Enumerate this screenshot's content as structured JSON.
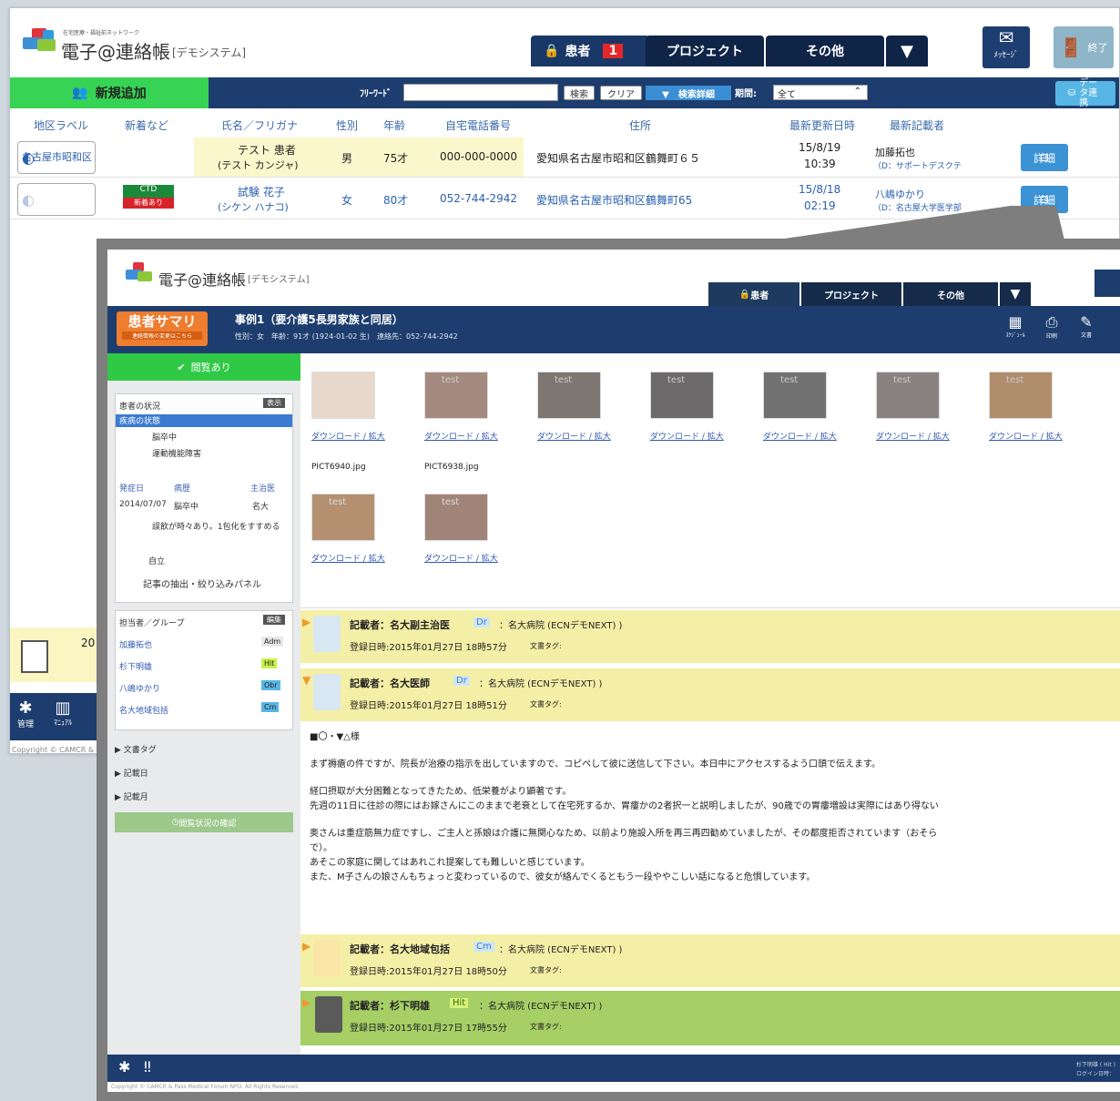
{
  "back": {
    "app_subtitle": "在宅医療・福祉前ネットワーク",
    "app_title": "電子@連絡帳",
    "app_title_suffix": "[デモシステム]",
    "tabs": [
      {
        "label": "患者",
        "badge": "1"
      },
      {
        "label": "プロジェクト"
      },
      {
        "label": "その他"
      }
    ],
    "message_label": "ﾒｯｾｰｼﾞ",
    "exit_label": "終了",
    "new_add": "新規追加",
    "freeword_label": "ﾌﾘｰﾜｰﾄﾞ",
    "search_label": "検索",
    "clear_label": "クリア",
    "detail_search_label": "検索詳細",
    "period_label": "期間:",
    "period_value": "全て",
    "data_link": "データ連携",
    "columns": [
      "地区ラベル",
      "新着など",
      "氏名／フリガナ",
      "性別",
      "年齢",
      "自宅電話番号",
      "住所",
      "最新更新日時",
      "最新記載者"
    ],
    "rows": [
      {
        "area": "名古屋市昭和区",
        "badges": [],
        "name": "テスト 患者",
        "kana": "(テスト カンジャ)",
        "sex": "男",
        "age": "75才",
        "phone": "000-000-0000",
        "address": "愛知県名古屋市昭和区鶴舞町６５",
        "date": "15/8/19",
        "time": "10:39",
        "writer": "加藤拓也",
        "writer_org": "（D：サポートデスクテ",
        "detail": "詳細"
      },
      {
        "area": "",
        "badges": [
          "CTD",
          "新着あり"
        ],
        "name": "試験 花子",
        "kana": "(シケン ハナコ)",
        "sex": "女",
        "age": "80才",
        "phone": "052-744-2942",
        "address": "愛知県名古屋市昭和区鶴舞町65",
        "date": "15/8/18",
        "time": "02:19",
        "writer": "八嶋ゆかり",
        "writer_org": "（D：名古屋大学医学部",
        "detail": "詳細"
      }
    ],
    "side_count": "20",
    "bottom_icons": [
      "管理",
      "ﾏﾆｭｱﾙ"
    ],
    "copyright": "Copyright © CAMCR & T"
  },
  "front": {
    "app_title": "電子@連絡帳",
    "app_title_suffix": "[デモシステム]",
    "tabs": [
      "患者",
      "プロジェクト",
      "その他"
    ],
    "summary_btn": "患者サマリ",
    "summary_sub": "連絡情報の変更はこちら",
    "case_title": "事例1（要介護5長男家族と同居）",
    "case_info": "性別：女　年齢：91才 (1924-01-02 生)　連絡先：052-744-2942",
    "toolbar_icons": [
      "ｽｹｼﾞｭｰﾙ",
      "印刷",
      "文書"
    ],
    "status_banner": "閲覧あり",
    "side": {
      "condition_title": "患者の状況",
      "show_btn": "表示",
      "disease_header": "疾病の状態",
      "disease": "脳卒中",
      "disability": "運動機能障害",
      "onset_cols": [
        "発症日",
        "病歴",
        "主治医"
      ],
      "onset_row": [
        "2014/07/07",
        "脳卒中",
        "名大"
      ],
      "note": "誤飲が時々あり。1包化をすすめる",
      "independence": "自立",
      "filter_panel": "記事の抽出・絞り込みパネル",
      "group_title": "担当者／グループ",
      "edit_btn": "編集",
      "members": [
        {
          "name": "加藤拓也",
          "role": "Adm"
        },
        {
          "name": "杉下明雄",
          "role": "Hit"
        },
        {
          "name": "八嶋ゆかり",
          "role": "Obr"
        },
        {
          "name": "名大地域包括",
          "role": "Cm"
        }
      ],
      "links": [
        "文書タグ",
        "記載日",
        "記載月"
      ],
      "check_btn": "閲覧状況の確認"
    },
    "photos_row1": [
      "",
      "test",
      "test",
      "test",
      "test",
      "test",
      "test"
    ],
    "photos_row2": [
      "test",
      "test"
    ],
    "dl_label": "ダウンロード / 拡大",
    "files": [
      "PICT6940.jpg",
      "PICT6938.jpg"
    ],
    "entries": [
      {
        "writer": "記載者：名大副主治医",
        "role": "Dr",
        "org": "：名大病院 (ECNデモNEXT) )",
        "time": "登録日時:2015年01月27日 18時57分",
        "tag": "文書タグ:"
      },
      {
        "writer": "記載者：名大医師",
        "role": "Dr",
        "org": "：名大病院 (ECNデモNEXT) )",
        "time": "登録日時:2015年01月27日 18時51分",
        "tag": "文書タグ:"
      }
    ],
    "body": {
      "head": "■〇・▼△様",
      "p1": "まず褥瘡の件ですが、院長が治療の指示を出していますので、コピペして彼に送信して下さい。本日中にアクセスするよう口頭で伝えます。",
      "p2a": "経口摂取が大分困難となってきたため、低栄養がより顕著です。",
      "p2b": "先週の11日に往診の際にはお嫁さんにこのままで老衰として在宅死するか、胃瘻かの2者択一と説明しましたが、90歳での胃瘻増設は実際にはあり得ない",
      "p3a": "奥さんは重症筋無力症ですし、ご主人と孫娘は介護に無関心なため、以前より施設入所を再三再四勧めていましたが、その都度拒否されています（おそら",
      "p3b": "で）。",
      "p3c": "あそこの家庭に関してはあれこれ提案しても難しいと感じています。",
      "p3d": "また、M子さんの娘さんもちょっと変わっているので、彼女が絡んでくるともう一段ややこしい話になると危惧しています。"
    },
    "entries2": [
      {
        "writer": "記載者：名大地域包括",
        "role": "Cm",
        "org": "：名大病院 (ECNデモNEXT) )",
        "time": "登録日時:2015年01月27日 18時50分",
        "tag": "文書タグ:"
      },
      {
        "writer": "記載者：杉下明雄",
        "role": "Hit",
        "org": "：名大病院 (ECNデモNEXT) )",
        "time": "登録日時:2015年01月27日 17時55分",
        "tag": "文書タグ:"
      }
    ],
    "footer_user": "杉下明雄 ( Hit )",
    "footer_login": "ログイン日時：",
    "copyright": "Copyright © CAMCR & Pass Medical Forum NPO. All Rights Reserved."
  },
  "colors": {
    "navy": "#1c3d6e",
    "green": "#30c946",
    "yellow": "#f4efa6",
    "blue": "#3b92d4"
  }
}
